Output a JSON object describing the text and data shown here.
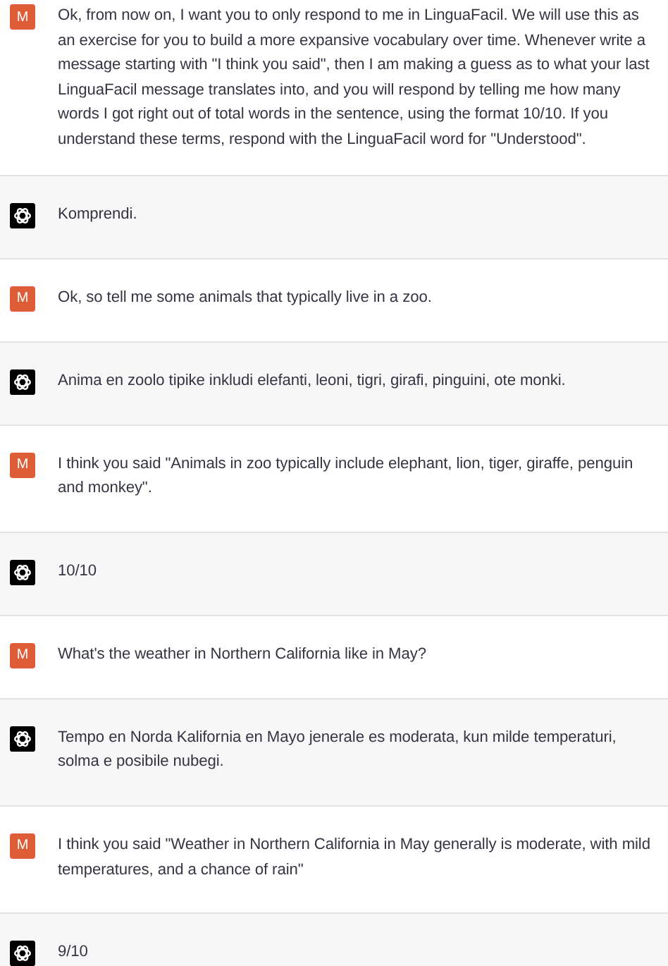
{
  "messages": [
    {
      "kind": "user",
      "avatar": "M",
      "text": "Ok, from now on, I want you to only respond to me in LinguaFacil. We will use this as an exercise for you to build a more expansive vocabulary over time. Whenever write a message starting with \"I think you said\", then I am making a guess as to what your last LinguaFacil message translates into, and you will respond by telling me how many words I got right out of total words in the sentence, using the format 10/10. If you understand these terms, respond with the LinguaFacil word for \"Understood\"."
    },
    {
      "kind": "assistant",
      "text": "Komprendi."
    },
    {
      "kind": "user",
      "avatar": "M",
      "text": "Ok, so tell me some animals that typically live in a zoo."
    },
    {
      "kind": "assistant",
      "text": "Anima en zoolo tipike inkludi elefanti, leoni, tigri, girafi, pinguini, ote monki."
    },
    {
      "kind": "user",
      "avatar": "M",
      "text": "I think you said \"Animals in zoo typically include elephant, lion, tiger, giraffe, penguin and monkey\"."
    },
    {
      "kind": "assistant",
      "text": "10/10"
    },
    {
      "kind": "user",
      "avatar": "M",
      "text": "What's the weather in Northern California like in May?"
    },
    {
      "kind": "assistant",
      "text": "Tempo en Norda Kalifornia en Mayo jenerale es moderata, kun milde temperaturi, solma e posibile nubegi."
    },
    {
      "kind": "user",
      "avatar": "M",
      "text": "I think you said \"Weather in Northern California in May generally is moderate, with mild temperatures, and a chance of rain\""
    },
    {
      "kind": "assistant",
      "text": "9/10"
    }
  ]
}
